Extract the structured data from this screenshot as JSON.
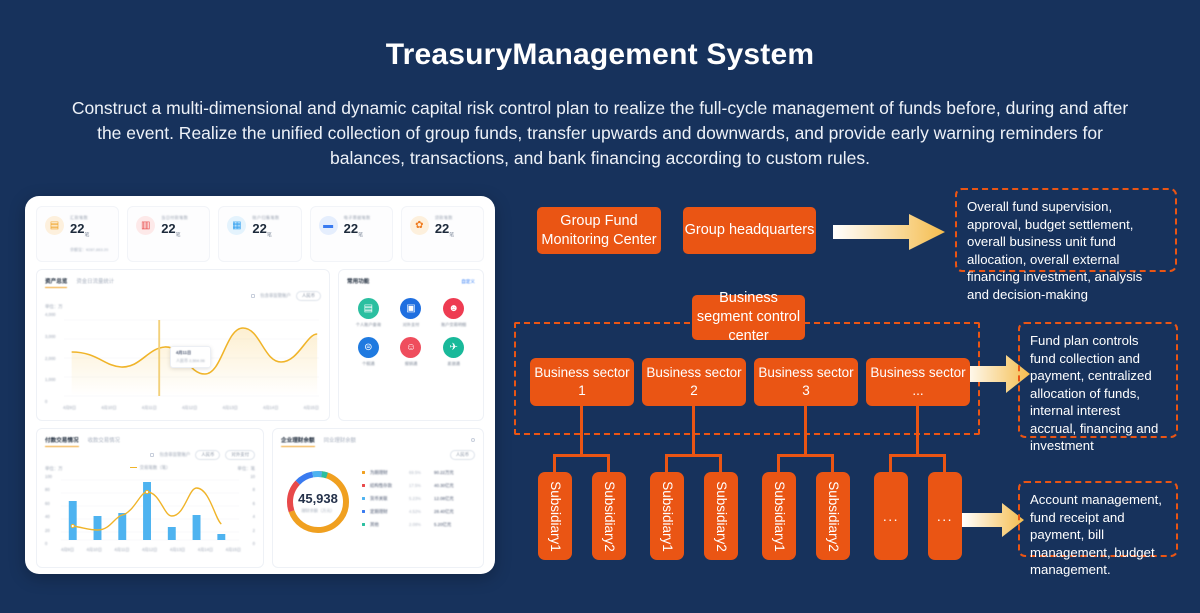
{
  "header": {
    "title": "TreasuryManagement System",
    "subtitle": "Construct a multi-dimensional and dynamic capital risk control plan to realize the full-cycle management of funds before, during and after the event. Realize the unified collection of group funds, transfer upwards and downwards, and provide early warning reminders for balances, transactions, and bank financing according to custom rules."
  },
  "colors": {
    "background": "#17325c",
    "accent_orange": "#ea5514",
    "arrow_gold": "#f5c45e",
    "chart_yellow": "#f0b429",
    "chart_blue": "#4eb3f0",
    "text_white": "#ffffff"
  },
  "diagram": {
    "top_boxes": [
      {
        "label": "Group Fund Monitoring Center"
      },
      {
        "label": "Group headquarters"
      }
    ],
    "control_center": {
      "label": "Business segment control center"
    },
    "sectors": [
      {
        "label": "Business sector 1"
      },
      {
        "label": "Business sector 2"
      },
      {
        "label": "Business sector 3"
      },
      {
        "label": "Business sector ..."
      }
    ],
    "subsidiaries": [
      {
        "label": "Subsidiary1"
      },
      {
        "label": "Subsidiary2"
      },
      {
        "label": "Subsidiary1"
      },
      {
        "label": "Subsidiary2"
      },
      {
        "label": "Subsidiary1"
      },
      {
        "label": "Subsidiary2"
      },
      {
        "label": "..."
      },
      {
        "label": "..."
      }
    ],
    "notes": [
      {
        "text": "Overall fund supervision, approval, budget settlement, overall business unit fund allocation, overall external financing investment, analysis and decision-making"
      },
      {
        "text": "Fund plan controls fund collection and payment, centralized allocation of funds, internal interest accrual, financing and investment"
      },
      {
        "text": "Account management, fund receipt and payment, bill management, budget management."
      }
    ],
    "arrows": [
      {
        "name": "arrow-to-note-1"
      },
      {
        "name": "arrow-to-note-2"
      },
      {
        "name": "arrow-to-note-3"
      }
    ]
  },
  "dashboard": {
    "kpis": [
      {
        "caption": "汇款笔数",
        "value": "22",
        "unit": "笔",
        "sub": "余额宝：¥287,863.20",
        "icon": "wallet-icon",
        "icon_bg": "#fdf0dd",
        "icon_fg": "#f0a020"
      },
      {
        "caption": "当日付款笔数",
        "value": "22",
        "unit": "笔",
        "sub": "",
        "icon": "bag-icon",
        "icon_bg": "#fde9e9",
        "icon_fg": "#e8494a"
      },
      {
        "caption": "账户归集笔数",
        "value": "22",
        "unit": "笔",
        "sub": "",
        "icon": "layers-icon",
        "icon_bg": "#e4f3fd",
        "icon_fg": "#36a2f0"
      },
      {
        "caption": "电子票据笔数",
        "value": "22",
        "unit": "笔",
        "sub": "",
        "icon": "card-icon",
        "icon_bg": "#e5eefd",
        "icon_fg": "#3a7bf0"
      },
      {
        "caption": "贷款笔数",
        "value": "22",
        "unit": "笔",
        "sub": "",
        "icon": "piggy-icon",
        "icon_bg": "#fdf0dd",
        "icon_fg": "#f07c20"
      }
    ],
    "line_card": {
      "tab_active": "资产总览",
      "tab_inactive": "资金日流量统计",
      "checkbox_label": "包含非监管账户",
      "currency": "人民币",
      "unit_label": "单位：万",
      "y_ticks": [
        "4,000",
        "3,000",
        "2,000",
        "1,000",
        "0"
      ],
      "x_ticks": [
        "4月9日",
        "4月10日",
        "4月11日",
        "4月12日",
        "4月13日",
        "4月14日",
        "4月15日"
      ],
      "tooltip_title": "4月11日",
      "tooltip_value": "人民币   2,504.06"
    },
    "apps_card": {
      "title": "常用功能",
      "link": "自定义",
      "apps": [
        {
          "label": "个人账户查询",
          "color": "#2bbfa0",
          "glyph": "▤"
        },
        {
          "label": "对外支付",
          "color": "#1f6fe0",
          "glyph": "▣"
        },
        {
          "label": "账户交易明细",
          "color": "#ee3c52",
          "glyph": "☻"
        },
        {
          "label": "个税通",
          "color": "#1f7ae0",
          "glyph": "⊜"
        },
        {
          "label": "报销通",
          "color": "#ef4d5d",
          "glyph": "☺"
        },
        {
          "label": "差旅通",
          "color": "#19b99a",
          "glyph": "✈"
        }
      ]
    },
    "bar_card": {
      "tab_active": "付款交易情况",
      "tab_inactive": "收款交易情况",
      "checkbox_label": "包含非监管账户",
      "currency": "人民币",
      "direction": "对外支付",
      "unit_left": "单位：万",
      "unit_right": "单位：笔",
      "series_label": "交易笔数（笔）",
      "x_ticks": [
        "4月9日",
        "4月10日",
        "4月11日",
        "4月12日",
        "4月13日",
        "4月14日",
        "4月15日"
      ],
      "y_left": [
        "100",
        "80",
        "60",
        "40",
        "20",
        "0"
      ],
      "y_right": [
        "10",
        "8",
        "6",
        "4",
        "2",
        "0"
      ]
    },
    "donut_card": {
      "tab_active": "企业理财余额",
      "tab_inactive": "同业理财余额",
      "currency": "人民币",
      "center_value": "45,938",
      "center_sub": "理财余额（万元）",
      "legend": [
        {
          "name": "为期理财",
          "pct": "69.5%",
          "amount": "90.22万元",
          "color": "#f0a020"
        },
        {
          "name": "结构性存款",
          "pct": "17.5%",
          "amount": "40.30亿元",
          "color": "#e8494a"
        },
        {
          "name": "货币关联",
          "pct": "5.23%",
          "amount": "12.08亿元",
          "color": "#4eb3f0"
        },
        {
          "name": "定期理财",
          "pct": "4.52%",
          "amount": "28.40亿元",
          "color": "#3a7bf0"
        },
        {
          "name": "其他",
          "pct": "2.08%",
          "amount": "5.20亿元",
          "color": "#2bbfa0"
        }
      ]
    }
  },
  "chart_data": [
    {
      "type": "line",
      "title": "资产总览",
      "xlabel": "",
      "ylabel": "单位：万",
      "x": [
        "4月9日",
        "4月10日",
        "4月11日",
        "4月12日",
        "4月13日",
        "4月14日",
        "4月15日"
      ],
      "values": [
        2450,
        2100,
        2600,
        1800,
        3750,
        2250,
        3450
      ],
      "ylim": [
        0,
        4000
      ],
      "grid": true,
      "legend": "none",
      "series_color": "#f0b429",
      "annotation": "4月11日  人民币 2,504.06"
    },
    {
      "type": "bar",
      "title": "付款交易情况",
      "x": [
        "4月9日",
        "4月10日",
        "4月11日",
        "4月12日",
        "4月13日",
        "4月14日",
        "4月15日"
      ],
      "ylim": [
        0,
        100
      ],
      "ylabel": "单位：万",
      "grid": true,
      "series": [
        {
          "name": "交易金额（万）",
          "type": "bar",
          "values": [
            60,
            36,
            41,
            88,
            20,
            38,
            9
          ],
          "color": "#4eb3f0"
        },
        {
          "name": "交易笔数（笔）",
          "type": "line",
          "values": [
            2.2,
            1.6,
            3.2,
            6.2,
            3.6,
            7.2,
            2.4
          ],
          "color": "#f0b429",
          "ylim": [
            0,
            10
          ]
        }
      ]
    },
    {
      "type": "pie",
      "title": "企业理财余额",
      "center_label": "45,938",
      "labels": [
        "为期理财",
        "结构性存款",
        "货币关联",
        "定期理财",
        "其他"
      ],
      "values": [
        69.5,
        17.5,
        5.23,
        4.52,
        2.08
      ],
      "colors": [
        "#f0a020",
        "#e8494a",
        "#4eb3f0",
        "#3a7bf0",
        "#2bbfa0"
      ],
      "legend": "right"
    }
  ]
}
